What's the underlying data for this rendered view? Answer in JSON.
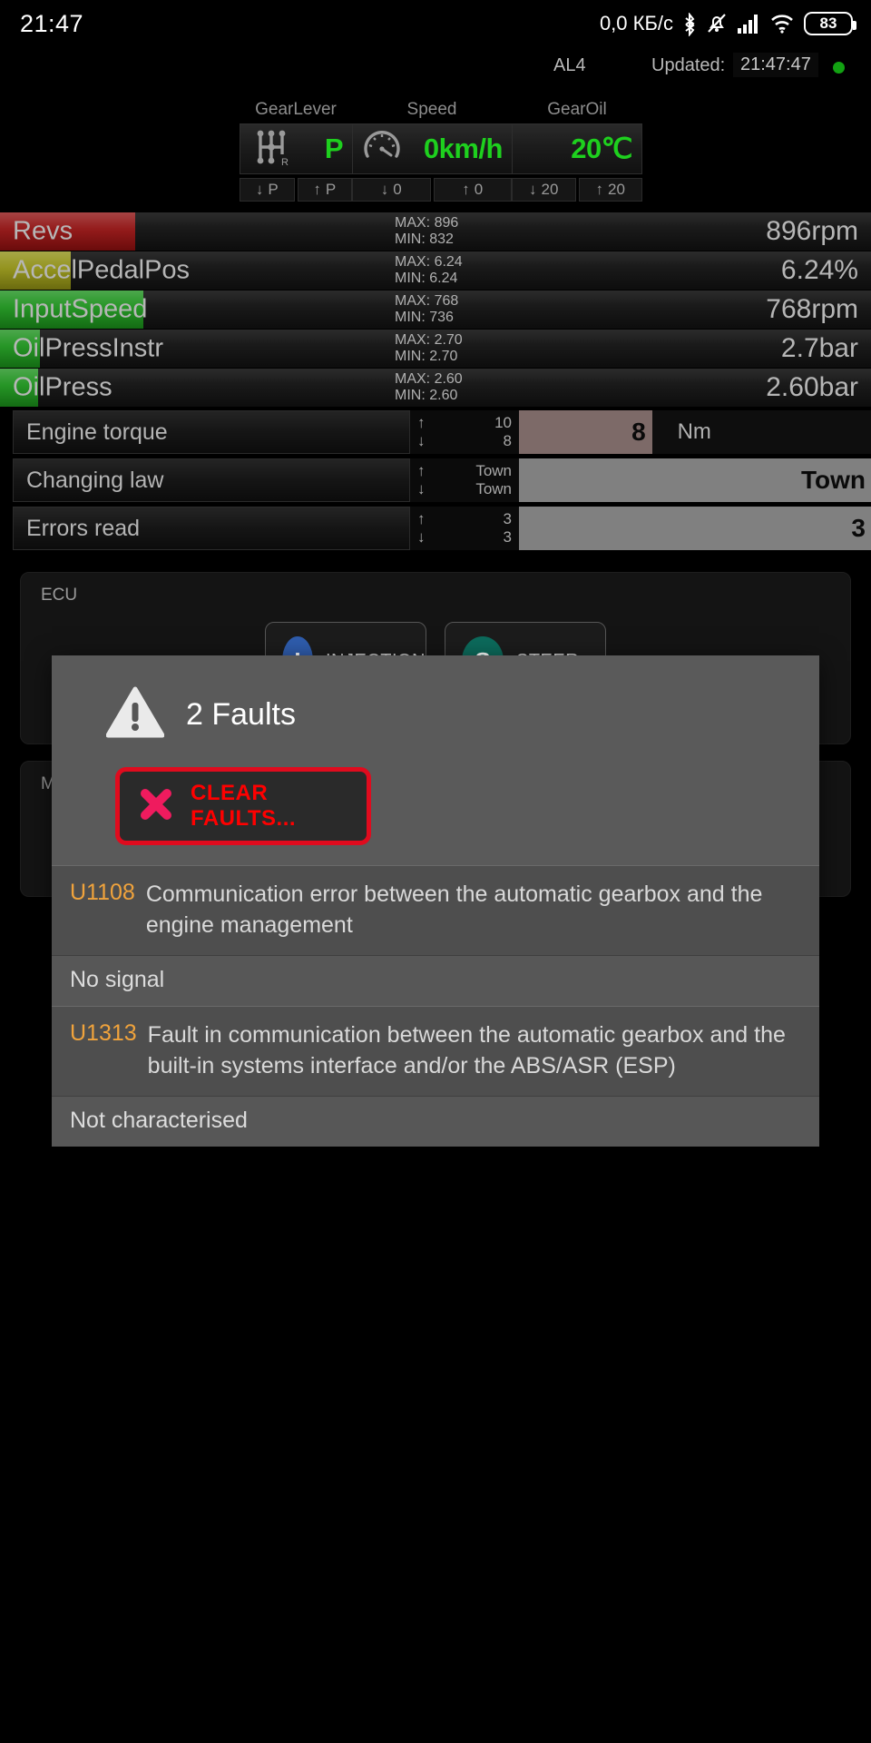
{
  "status_bar": {
    "clock": "21:47",
    "network_speed": "0,0 КБ/с",
    "battery_level": "83",
    "icons": [
      "bluetooth-icon",
      "mute-icon",
      "signal-icon",
      "wifi-icon",
      "battery-icon"
    ]
  },
  "header": {
    "ecu_name": "AL4",
    "updated_label": "Updated:",
    "updated_time": "21:47:47",
    "connection_dot_color": "#12a112"
  },
  "gauges": [
    {
      "title": "GearLever",
      "value": "P",
      "icon": "gear-lever-icon",
      "min": "P",
      "max": "P",
      "value_color": "#1ed01e"
    },
    {
      "title": "Speed",
      "value": "0km/h",
      "icon": "speedometer-icon",
      "min": "0",
      "max": "0",
      "value_color": "#1ed01e"
    },
    {
      "title": "GearOil",
      "value": "20℃",
      "icon": "",
      "min": "20",
      "max": "20",
      "value_color": "#1ed01e"
    }
  ],
  "bars": [
    {
      "name": "Revs",
      "max": "MAX: 896",
      "min": "MIN: 832",
      "value": "896rpm",
      "fill_pct": 15.5,
      "color": "#8e0f0f"
    },
    {
      "name": "AccelPedalPos",
      "max": "MAX: 6.24",
      "min": "MIN: 6.24",
      "value": "6.24%",
      "fill_pct": 8.1,
      "color": "#8e8e13"
    },
    {
      "name": "InputSpeed",
      "max": "MAX: 768",
      "min": "MIN: 736",
      "value": "768rpm",
      "fill_pct": 16.5,
      "color": "#1a8f1a"
    },
    {
      "name": "OilPressInstr",
      "max": "MAX: 2.70",
      "min": "MIN: 2.70",
      "value": "2.7bar",
      "fill_pct": 4.6,
      "color": "#1a8f1a"
    },
    {
      "name": "OilPress",
      "max": "MAX: 2.60",
      "min": "MIN: 2.60",
      "value": "2.60bar",
      "fill_pct": 4.4,
      "color": "#1a8f1a"
    }
  ],
  "table_rows": [
    {
      "label": "Engine torque",
      "up": "10",
      "down": "8",
      "value": "8",
      "unit": "Nm",
      "fill_pct": 38,
      "color": "#7d6a68",
      "align": "right"
    },
    {
      "label": "Changing law",
      "up": "Town",
      "down": "Town",
      "value": "Town",
      "unit": "",
      "fill_pct": 100,
      "color": "#808080",
      "align": "right"
    },
    {
      "label": "Errors read",
      "up": "3",
      "down": "3",
      "value": "3",
      "unit": "",
      "fill_pct": 100,
      "color": "#808080",
      "align": "right"
    }
  ],
  "ecu_panel": {
    "title": "ECU",
    "chips": [
      {
        "badge": "I",
        "label": "INJECTION",
        "color": "#2f5dae"
      },
      {
        "badge": "S",
        "label": "STEER",
        "color": "#0c6b5c"
      }
    ]
  },
  "memory_panel": {
    "title": "Me"
  },
  "dialog": {
    "warning_icon": "warning-triangle-icon",
    "title": "2 Faults",
    "clear_button_label": "CLEAR FAULTS...",
    "clear_button_icon": "close-x-icon",
    "faults": [
      {
        "code": "U1108",
        "description": "Communication error between the automatic gearbox and the engine management",
        "status": "No signal"
      },
      {
        "code": "U1313",
        "description": "Fault in communication between the automatic gearbox and the built-in systems interface and/or the ABS/ASR (ESP)",
        "status": "Not characterised"
      }
    ]
  }
}
